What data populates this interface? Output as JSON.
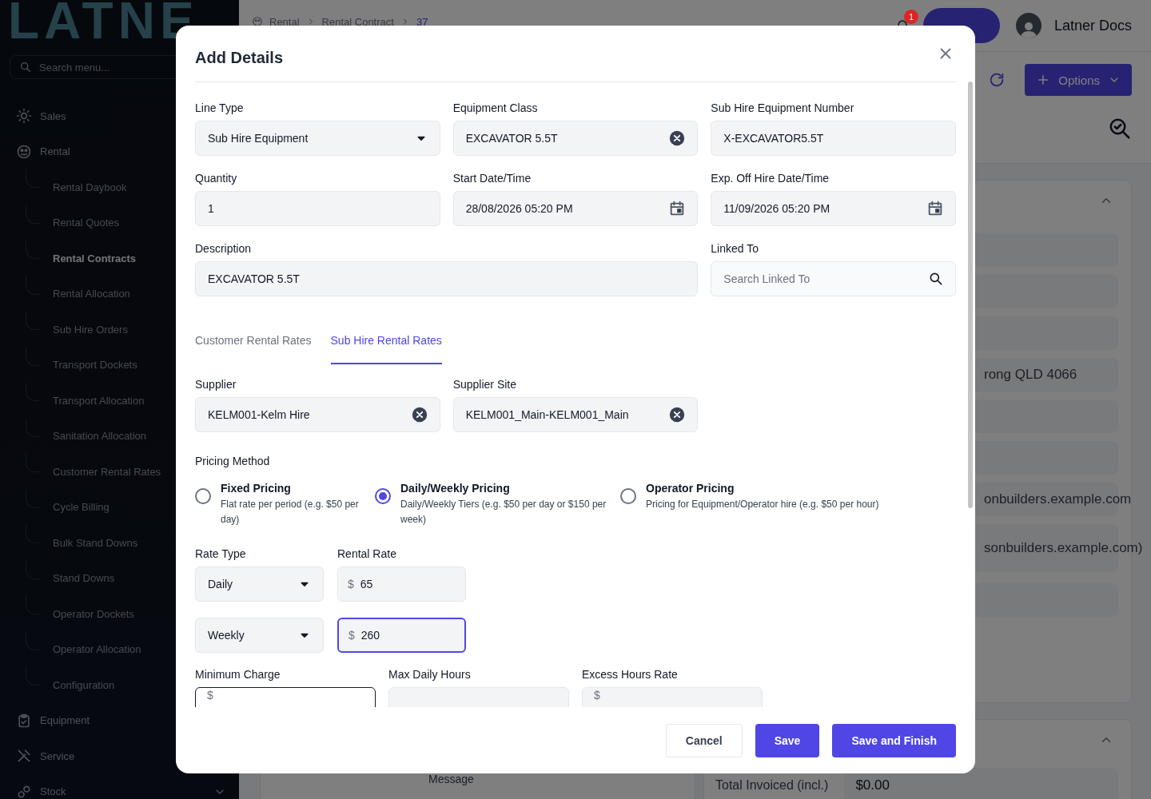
{
  "sidebar": {
    "logo": "LATNE",
    "search": {
      "placeholder": "Search menu..."
    },
    "items": [
      {
        "label": "Sales"
      },
      {
        "label": "Rental",
        "expanded": true,
        "children": [
          {
            "label": "Rental Daybook",
            "selected": false
          },
          {
            "label": "Rental Quotes",
            "selected": false
          },
          {
            "label": "Rental Contracts",
            "selected": true
          },
          {
            "label": "Rental Allocation",
            "selected": false
          },
          {
            "label": "Sub Hire Orders",
            "selected": false
          },
          {
            "label": "Transport Dockets",
            "selected": false
          },
          {
            "label": "Transport Allocation",
            "selected": false
          },
          {
            "label": "Sanitation Allocation",
            "selected": false
          },
          {
            "label": "Customer Rental Rates",
            "selected": false
          },
          {
            "label": "Cycle Billing",
            "selected": false
          },
          {
            "label": "Bulk Stand Downs",
            "selected": false
          },
          {
            "label": "Stand Downs",
            "selected": false
          },
          {
            "label": "Operator Dockets",
            "selected": false
          },
          {
            "label": "Operator Allocation",
            "selected": false
          },
          {
            "label": "Configuration",
            "selected": false
          }
        ]
      },
      {
        "label": "Equipment"
      },
      {
        "label": "Service"
      },
      {
        "label": "Stock",
        "expanded": false
      }
    ]
  },
  "topbar": {
    "breadcrumb": [
      "Rental",
      "Rental Contract",
      "37"
    ],
    "notifications": "1",
    "user": "Latner Docs"
  },
  "toolbar": {
    "options": "Options"
  },
  "details_card": {
    "rows": [
      {
        "kind": "blank"
      },
      {
        "kind": "blank"
      },
      {
        "kind": "blank"
      },
      {
        "kind": "text",
        "text": "rong QLD 4066"
      },
      {
        "kind": "blank"
      },
      {
        "kind": "blank"
      },
      {
        "kind": "text",
        "text": "onbuilders.example.com"
      },
      {
        "kind": "tall",
        "text": "sonbuilders.example.com)"
      },
      {
        "kind": "blank"
      }
    ]
  },
  "message_card": {
    "label": "Message"
  },
  "summary_card": {
    "label": "Total Invoiced (incl.)",
    "value": "$0.00"
  },
  "modal": {
    "title": "Add Details",
    "fields": [
      {
        "label": "Line Type",
        "kind": "select",
        "value": "Sub Hire Equipment",
        "wide": false
      },
      {
        "label": "Equipment Class",
        "kind": "clearable",
        "value": "EXCAVATOR 5.5T",
        "wide": false
      },
      {
        "label": "Sub Hire Equipment Number",
        "kind": "text",
        "value": "X-EXCAVATOR5.5T",
        "wide": false
      },
      {
        "label": "Quantity",
        "kind": "text",
        "value": "1",
        "wide": false
      },
      {
        "label": "Start Date/Time",
        "kind": "date",
        "value": "28/08/2026 05:20 PM",
        "wide": false
      },
      {
        "label": "Exp. Off Hire Date/Time",
        "kind": "date",
        "value": "11/09/2026 05:20 PM",
        "wide": false
      },
      {
        "label": "Description",
        "kind": "text",
        "value": "EXCAVATOR 5.5T",
        "wide": true
      },
      {
        "label": "Linked To",
        "kind": "search",
        "placeholder": "Search Linked To",
        "wide": false
      }
    ],
    "tabs": [
      {
        "label": "Customer Rental Rates",
        "selected": false
      },
      {
        "label": "Sub Hire Rental Rates",
        "selected": true
      }
    ],
    "supplier_fields": [
      {
        "label": "Supplier",
        "kind": "clearable",
        "value": "KELM001-Kelm Hire",
        "wide": false
      },
      {
        "label": "Supplier Site",
        "kind": "clearable",
        "value": "KELM001_Main-KELM001_Main",
        "wide": false
      }
    ],
    "pricing": {
      "label": "Pricing Method",
      "options": [
        {
          "title": "Fixed Pricing",
          "description": "Flat rate per period (e.g. $50 per day)",
          "selected": false
        },
        {
          "title": "Daily/Weekly Pricing",
          "description": "Daily/Weekly Tiers (e.g. $50 per day or $150 per week)",
          "selected": true
        },
        {
          "title": "Operator Pricing",
          "description": "Pricing for Equipment/Operator hire (e.g. $50 per hour)",
          "selected": false
        }
      ]
    },
    "rates": {
      "type_label": "Rate Type",
      "rate_label": "Rental Rate",
      "rows": [
        {
          "type": "Daily",
          "currency": "$",
          "amount": "65",
          "focused": false
        },
        {
          "type": "Weekly",
          "currency": "$",
          "amount": "260",
          "focused": true
        }
      ]
    },
    "extra_fields": [
      {
        "label": "Minimum Charge",
        "prefix": "$",
        "focused": true
      },
      {
        "label": "Max Daily Hours",
        "focused": false
      },
      {
        "label": "Excess Hours Rate",
        "prefix": "$",
        "focused": false
      }
    ],
    "buttons": [
      {
        "label": "Cancel",
        "kind": "secondary"
      },
      {
        "label": "Save",
        "kind": "primary"
      },
      {
        "label": "Save and Finish",
        "kind": "primary"
      }
    ]
  }
}
